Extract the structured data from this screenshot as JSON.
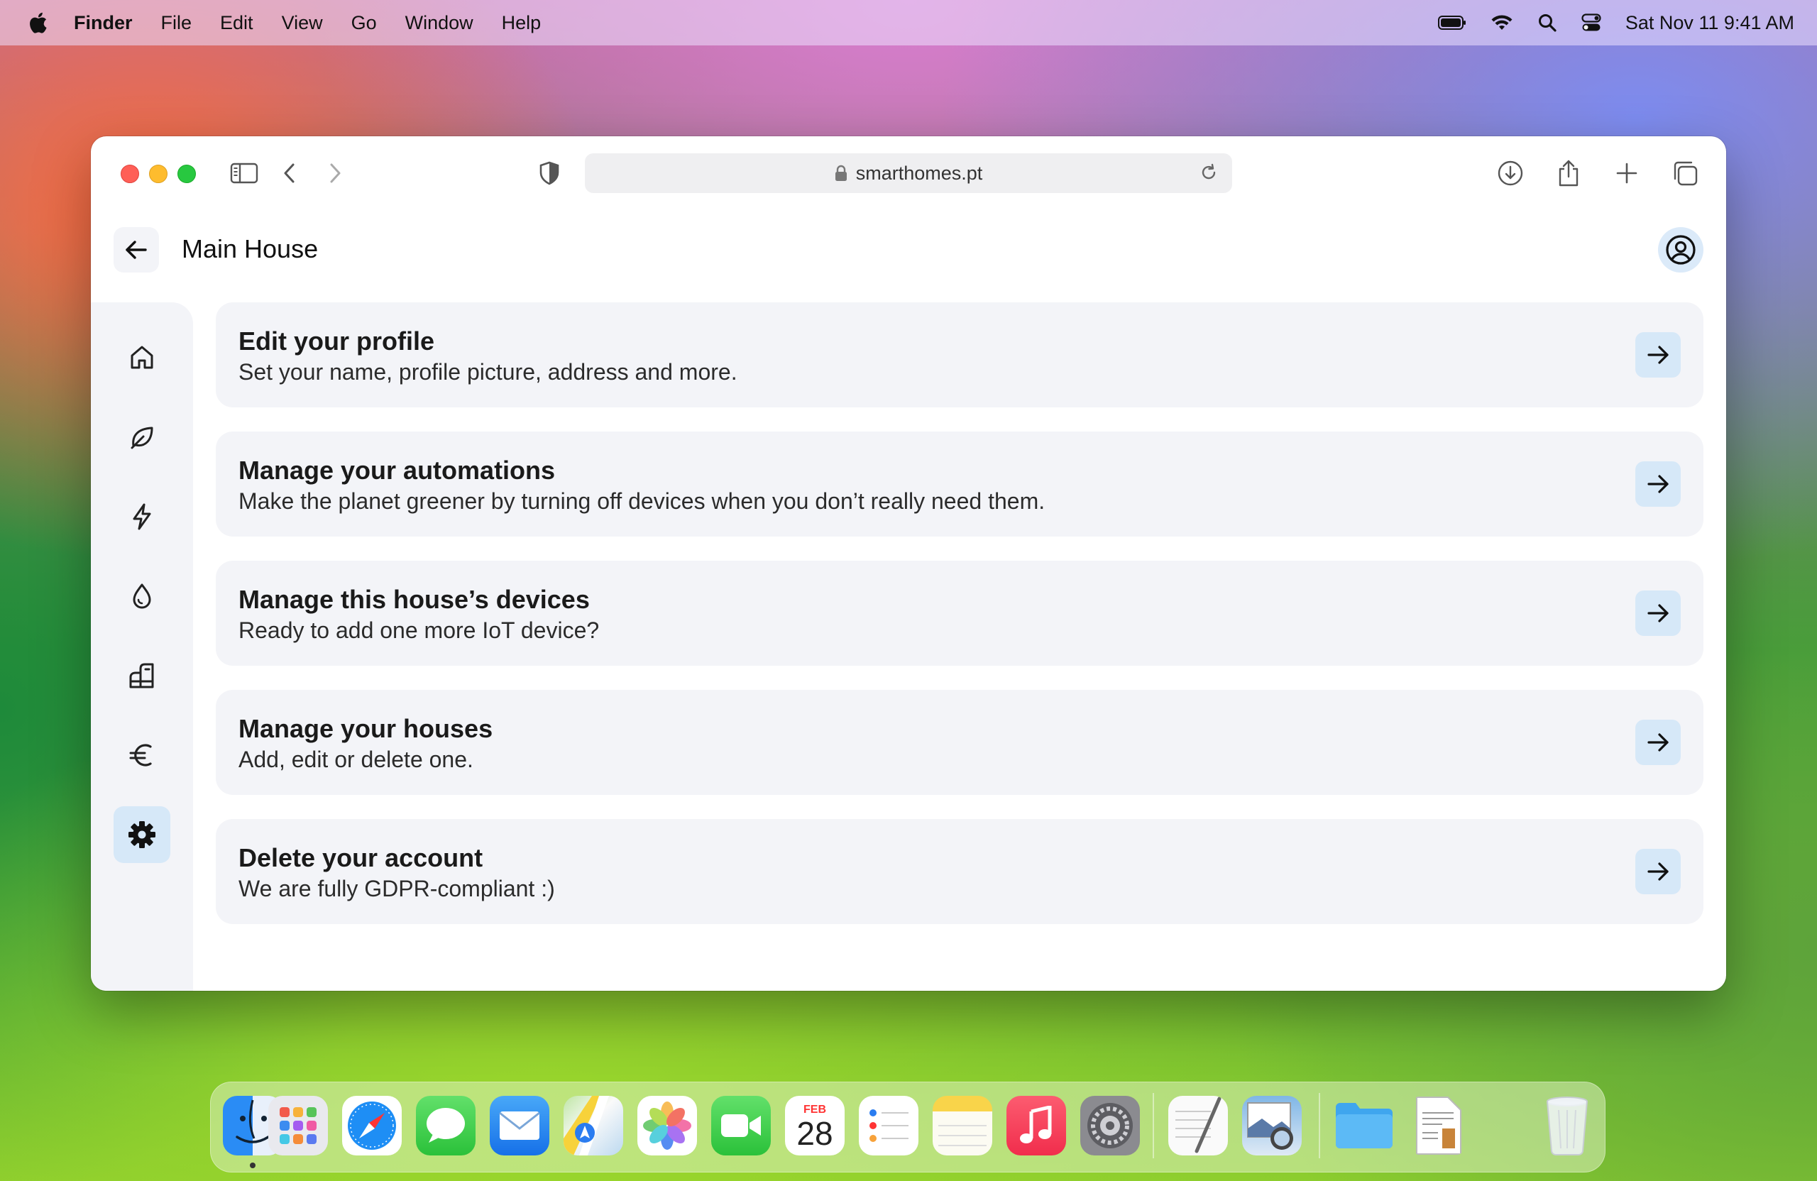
{
  "menubar": {
    "app_name": "Finder",
    "items": [
      "File",
      "Edit",
      "View",
      "Go",
      "Window",
      "Help"
    ],
    "clock": "Sat Nov 11  9:41 AM",
    "status_icons": [
      "battery-icon",
      "wifi-icon",
      "spotlight-search-icon",
      "control-center-icon"
    ]
  },
  "browser": {
    "url": "smarthomes.pt",
    "toolbar_icons": [
      "sidebar-toggle-icon",
      "back-chevron-icon",
      "forward-chevron-icon",
      "privacy-shield-icon",
      "download-icon",
      "share-icon",
      "new-tab-icon",
      "tab-overview-icon"
    ]
  },
  "app": {
    "title": "Main House",
    "accent_color": "#d6e8f8",
    "sidebar": [
      {
        "icon": "home-icon",
        "active": false
      },
      {
        "icon": "leaf-icon",
        "active": false
      },
      {
        "icon": "lightning-icon",
        "active": false
      },
      {
        "icon": "water-drop-icon",
        "active": false
      },
      {
        "icon": "appliance-icon",
        "active": false
      },
      {
        "icon": "euro-icon",
        "active": false
      },
      {
        "icon": "gear-icon",
        "active": true
      }
    ],
    "cards": [
      {
        "title": "Edit your profile",
        "subtitle": "Set your name, profile picture, address and more."
      },
      {
        "title": "Manage your automations",
        "subtitle": "Make the planet greener by turning off devices when you don’t really need them."
      },
      {
        "title": "Manage this house’s devices",
        "subtitle": "Ready to add one more IoT device?"
      },
      {
        "title": "Manage your houses",
        "subtitle": "Add, edit or delete one."
      },
      {
        "title": "Delete your account",
        "subtitle": "We are fully GDPR-compliant :)"
      }
    ]
  },
  "dock": {
    "apps": [
      "Finder",
      "Launchpad",
      "Safari",
      "Messages",
      "Mail",
      "Maps",
      "Photos",
      "FaceTime",
      "Calendar",
      "Reminders",
      "Notes",
      "Music",
      "System Settings",
      "TextEdit",
      "Preview",
      "Folder",
      "Document",
      "Trash"
    ],
    "calendar_month": "FEB",
    "calendar_day": "28"
  }
}
